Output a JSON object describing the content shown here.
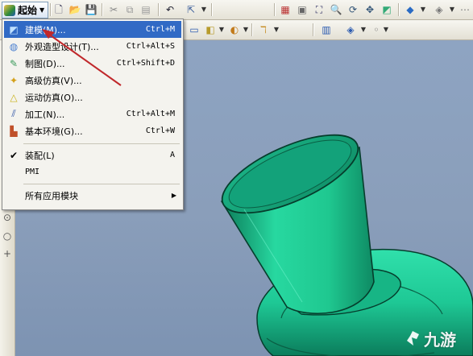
{
  "start_button": {
    "label": "起始",
    "icon": "start-icon"
  },
  "toolbar1": {
    "icons": [
      "new-file-icon",
      "open-folder-icon",
      "save-icon",
      "cut-icon",
      "copy-icon",
      "paste-icon",
      "undo-icon",
      "select-tool-icon",
      "grid-icon",
      "view-icon",
      "zoom-fit-icon",
      "zoom-icon",
      "rotate-icon",
      "pan-icon",
      "shade-icon",
      "box-icon",
      "render-icon"
    ]
  },
  "toolbar2": {
    "icons": [
      "sketch-icon",
      "extrude-icon",
      "sphere-icon",
      "feature-icon",
      "curve-icon",
      "assembly-icon",
      "view-orient-icon"
    ]
  },
  "menu": {
    "items": [
      {
        "label": "建模(M)...",
        "shortcut": "Ctrl+M",
        "icon": "modeling-icon",
        "active": true
      },
      {
        "label": "外观造型设计(T)...",
        "shortcut": "Ctrl+Alt+S",
        "icon": "shape-studio-icon"
      },
      {
        "label": "制图(D)...",
        "shortcut": "Ctrl+Shift+D",
        "icon": "drafting-icon"
      },
      {
        "label": "高级仿真(V)...",
        "shortcut": "",
        "icon": "advanced-simulation-icon"
      },
      {
        "label": "运动仿真(O)...",
        "shortcut": "",
        "icon": "motion-simulation-icon"
      },
      {
        "label": "加工(N)...",
        "shortcut": "Ctrl+Alt+M",
        "icon": "manufacturing-icon"
      },
      {
        "label": "基本环境(G)...",
        "shortcut": "Ctrl+W",
        "icon": "gateway-icon"
      },
      {
        "label": "装配(L)",
        "shortcut": "A",
        "icon": "check-icon",
        "checked": true
      },
      {
        "label": "PMI",
        "shortcut": "",
        "icon": ""
      },
      {
        "label": "所有应用模块",
        "shortcut": "",
        "icon": "",
        "submenu": true
      }
    ]
  },
  "watermark": {
    "text": "九游"
  },
  "colors": {
    "menu_highlight": "#316ac5",
    "viewport_background": "#8ea4c2",
    "part_color": "#1ecf9a",
    "annotation_arrow": "#c0282b"
  }
}
